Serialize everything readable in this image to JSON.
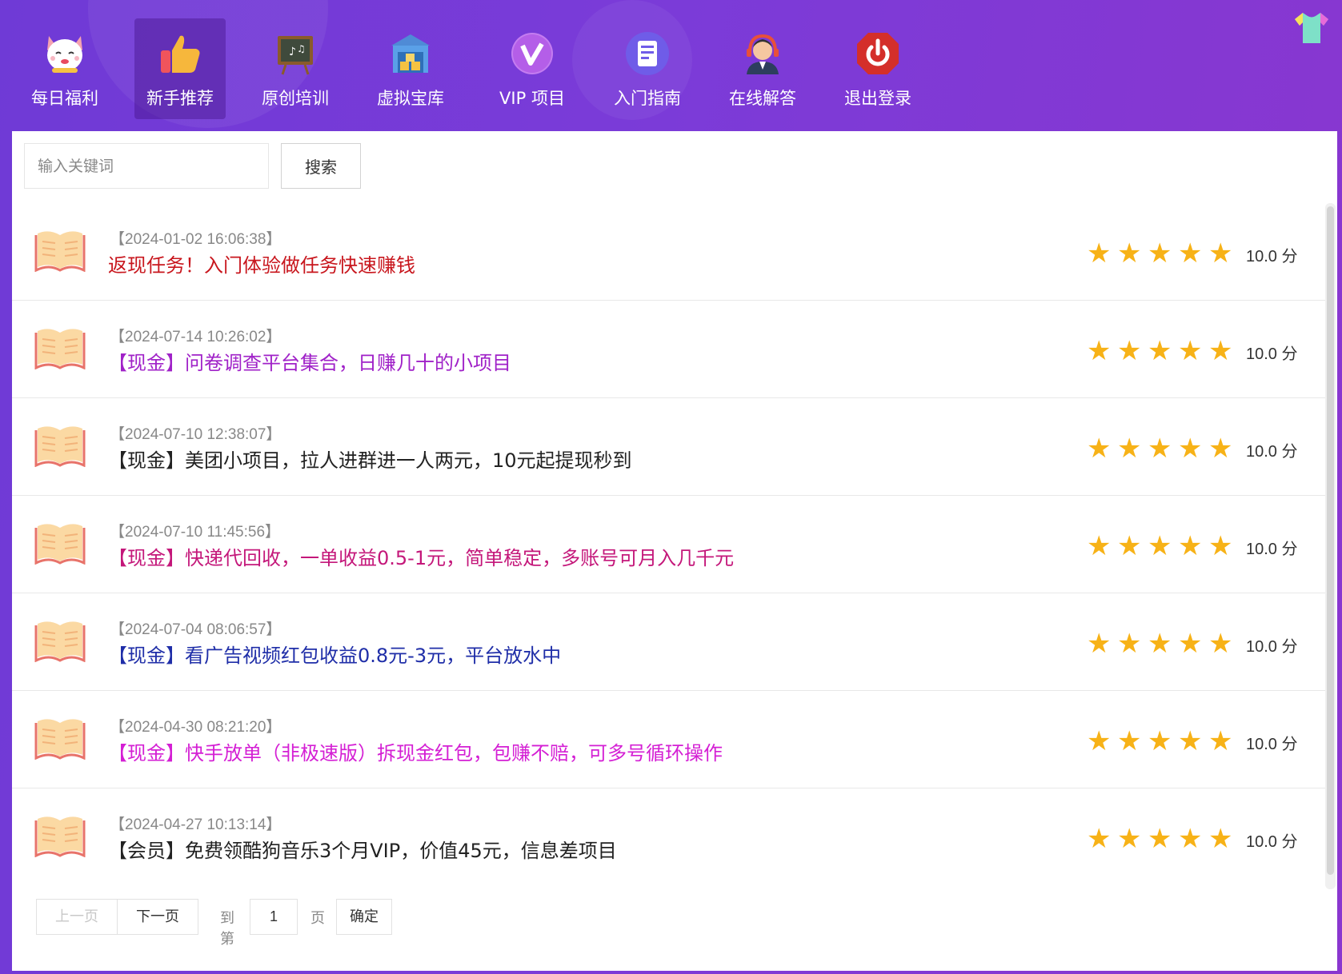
{
  "nav": {
    "items": [
      {
        "label": "每日福利",
        "icon": "lucky-cat-icon"
      },
      {
        "label": "新手推荐",
        "icon": "thumbs-up-icon"
      },
      {
        "label": "原创培训",
        "icon": "chalkboard-icon"
      },
      {
        "label": "虚拟宝库",
        "icon": "treasure-warehouse-icon"
      },
      {
        "label": "VIP 项目",
        "icon": "vip-icon"
      },
      {
        "label": "入门指南",
        "icon": "document-guide-icon"
      },
      {
        "label": "在线解答",
        "icon": "customer-service-icon"
      },
      {
        "label": "退出登录",
        "icon": "power-icon"
      }
    ],
    "active_index": 1,
    "skin_icon": "tshirt-icon"
  },
  "search": {
    "placeholder": "输入关键词",
    "button_label": "搜索"
  },
  "items": [
    {
      "date": "【2024-01-02 16:06:38】",
      "title": "返现任务！入门体验做任务快速赚钱",
      "title_color": "#c8161d",
      "rating": 5,
      "score": "10.0 分"
    },
    {
      "date": "【2024-07-14 10:26:02】",
      "title": "【现金】问卷调查平台集合，日赚几十的小项目",
      "title_color": "#a022c8",
      "rating": 5,
      "score": "10.0 分"
    },
    {
      "date": "【2024-07-10 12:38:07】",
      "title": "【现金】美团小项目，拉人进群进一人两元，10元起提现秒到",
      "title_color": "#222222",
      "rating": 5,
      "score": "10.0 分"
    },
    {
      "date": "【2024-07-10 11:45:56】",
      "title": "【现金】快递代回收，一单收益0.5-1元，简单稳定，多账号可月入几千元",
      "title_color": "#c4177a",
      "rating": 5,
      "score": "10.0 分"
    },
    {
      "date": "【2024-07-04 08:06:57】",
      "title": "【现金】看广告视频红包收益0.8元-3元，平台放水中",
      "title_color": "#1f2ea8",
      "rating": 5,
      "score": "10.0 分"
    },
    {
      "date": "【2024-04-30 08:21:20】",
      "title": "【现金】快手放单（非极速版）拆现金红包，包赚不赔，可多号循环操作",
      "title_color": "#d41fd4",
      "rating": 5,
      "score": "10.0 分"
    },
    {
      "date": "【2024-04-27 10:13:14】",
      "title": "【会员】免费领酷狗音乐3个月VIP，价值45元，信息差项目",
      "title_color": "#222222",
      "rating": 5,
      "score": "10.0 分"
    }
  ],
  "pagination": {
    "prev_label": "上一页",
    "next_label": "下一页",
    "goto_label": "到第",
    "page_value": "1",
    "page_suffix": "页",
    "confirm_label": "确定"
  },
  "colors": {
    "star": "#f7b217",
    "header_gradient_start": "#6f3ad6",
    "header_gradient_end": "#8a36cf"
  }
}
